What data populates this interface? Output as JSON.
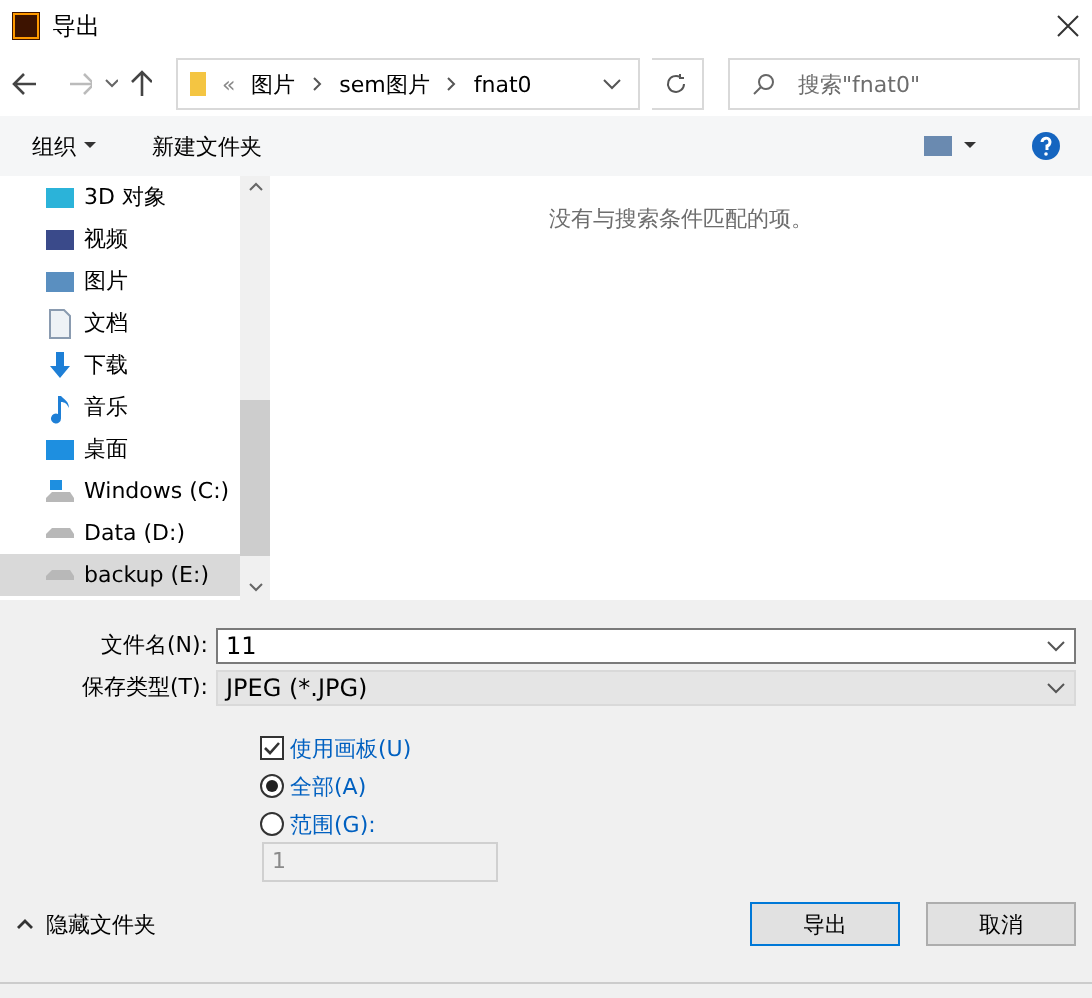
{
  "window": {
    "title": "导出"
  },
  "address": {
    "overflow": "«",
    "crumbs": [
      "图片",
      "sem图片",
      "fnat0"
    ]
  },
  "search": {
    "placeholder": "搜索\"fnat0\""
  },
  "toolbar": {
    "organize": "组织",
    "new_folder": "新建文件夹"
  },
  "sidebar": {
    "items": [
      {
        "label": "3D 对象",
        "kind": "cube",
        "selected": false
      },
      {
        "label": "视频",
        "kind": "video",
        "selected": false
      },
      {
        "label": "图片",
        "kind": "picture",
        "selected": false
      },
      {
        "label": "文档",
        "kind": "document",
        "selected": false
      },
      {
        "label": "下载",
        "kind": "download",
        "selected": false
      },
      {
        "label": "音乐",
        "kind": "music",
        "selected": false
      },
      {
        "label": "桌面",
        "kind": "desktop",
        "selected": false
      },
      {
        "label": "Windows (C:)",
        "kind": "windrive",
        "selected": false
      },
      {
        "label": "Data (D:)",
        "kind": "drive",
        "selected": false
      },
      {
        "label": "backup (E:)",
        "kind": "drive",
        "selected": true
      }
    ]
  },
  "empty_message": "没有与搜索条件匹配的项。",
  "filename": {
    "label": "文件名(N):",
    "value": "11"
  },
  "filetype": {
    "label": "保存类型(T):",
    "value": "JPEG (*.JPG)"
  },
  "options": [
    {
      "kind": "checkbox",
      "label": "使用画板(U)",
      "checked": true
    },
    {
      "kind": "radio",
      "label": "全部(A)",
      "selected": true
    },
    {
      "kind": "radio",
      "label": "范围(G):",
      "selected": false
    }
  ],
  "range_field": {
    "value": "1",
    "disabled": true
  },
  "hide_folders": "隐藏文件夹",
  "buttons": [
    {
      "label": "导出",
      "default": true
    },
    {
      "label": "取消",
      "default": false
    }
  ]
}
